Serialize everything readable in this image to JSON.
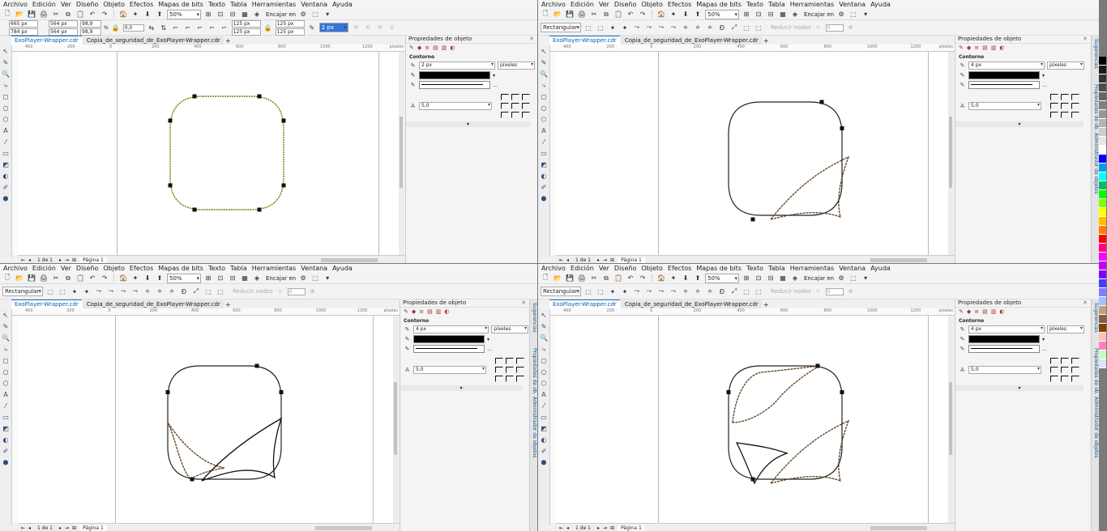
{
  "menu": [
    "Archivo",
    "Edición",
    "Ver",
    "Diseño",
    "Objeto",
    "Efectos",
    "Mapas de bits",
    "Texto",
    "Tabla",
    "Herramientas",
    "Ventana",
    "Ayuda"
  ],
  "toolbar": {
    "zoom": "50%",
    "snap": "Encajar en"
  },
  "property_bar_1": {
    "x": "665 px",
    "y": "784 px",
    "w": "564 px",
    "h": "564 px",
    "scale_x": "98,9",
    "scale_y": "98,9",
    "pct": "%",
    "angle": "0,0",
    "corner_a": "125 px",
    "corner_b": "125 px",
    "corner_c": "125 px",
    "corner_d": "125 px",
    "outline": "2 px"
  },
  "property_bar_2": {
    "mode": "Rectangular",
    "reduce_nodes": "Reducir nodos",
    "value": "0"
  },
  "tabs": [
    "ExoPlayer-Wrapper.cdr",
    "Copia_de_seguridad_de_ExoPlayer-Wrapper.cdr"
  ],
  "ruler_labels": [
    "400",
    "200",
    "0",
    "200",
    "400",
    "600",
    "800",
    "1000",
    "1200"
  ],
  "ruler_unit": "píxeles",
  "status": {
    "pages": "1 de 1",
    "page_tab": "Página 1"
  },
  "docker": {
    "title": "Propiedades de objeto",
    "section": "Contorno",
    "width_1": "2 px",
    "width_2": "4 px",
    "units": "píxeles",
    "miter": "5,0"
  },
  "side_tabs": [
    "Sugerencias",
    "Propiedades de ob.",
    "Administrador de objetos"
  ],
  "palette_colors": [
    "#000000",
    "#1a1a1a",
    "#333333",
    "#4d4d4d",
    "#666666",
    "#808080",
    "#999999",
    "#b3b3b3",
    "#cccccc",
    "#e6e6e6",
    "#ffffff",
    "#0000ff",
    "#00a0e0",
    "#00ffff",
    "#00c060",
    "#00ff00",
    "#80ff00",
    "#ffff00",
    "#ffc000",
    "#ff8000",
    "#ff0000",
    "#ff0080",
    "#ff00ff",
    "#c000ff",
    "#8000ff",
    "#4040ff",
    "#8080ff",
    "#a0c0ff",
    "#c0a080",
    "#806040",
    "#804000",
    "#ffc0c0",
    "#ff80c0",
    "#c0ffc0",
    "#e0e0ff"
  ]
}
